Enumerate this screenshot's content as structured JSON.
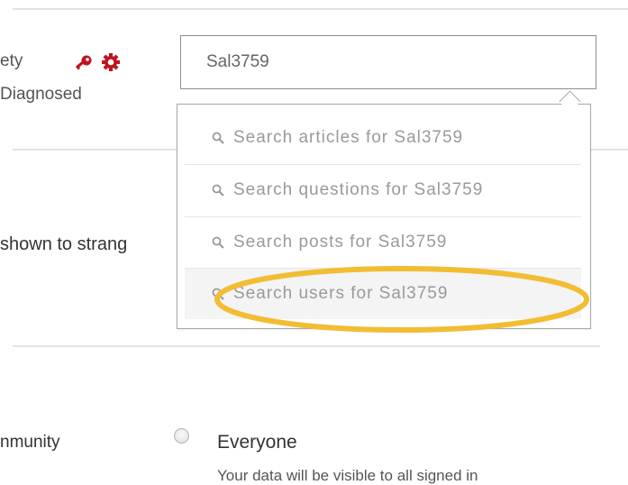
{
  "profile": {
    "name_fragment": "ety",
    "status_fragment": "Diagnosed",
    "icons": [
      "key-icon",
      "gear-icon"
    ],
    "icon_color": "#c1121f"
  },
  "search": {
    "value": "Sal3759"
  },
  "dropdown": {
    "items": [
      {
        "label": "Search articles for Sal3759"
      },
      {
        "label": "Search questions for Sal3759"
      },
      {
        "label": "Search posts for Sal3759"
      },
      {
        "label": "Search users for Sal3759"
      }
    ],
    "highlight_color": "#f2bd33"
  },
  "privacy": {
    "label_fragment": "shown to strang"
  },
  "community": {
    "label_fragment": "nmunity",
    "option_label": "Everyone",
    "option_description": "Your data will be visible to all signed in"
  }
}
